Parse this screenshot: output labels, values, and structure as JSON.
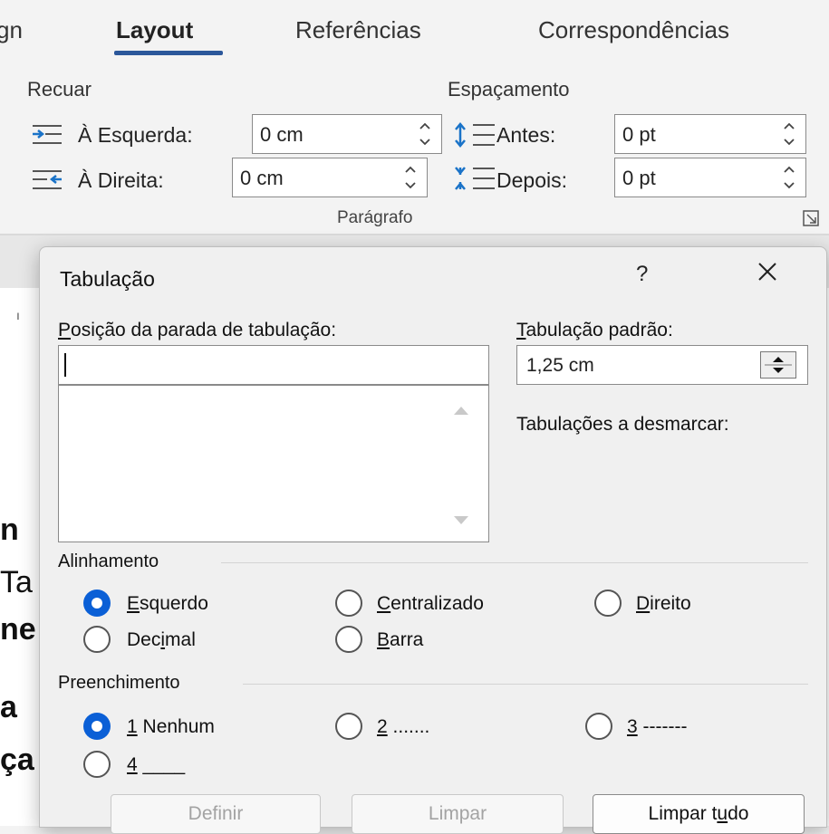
{
  "ribbon": {
    "tabs": [
      {
        "label": "gn"
      },
      {
        "label": "Layout"
      },
      {
        "label": "Referências"
      },
      {
        "label": "Correspondências"
      }
    ],
    "recuar": {
      "title": "Recuar",
      "left_label": "À Esquerda:",
      "left_value": "0 cm",
      "right_label": "À Direita:",
      "right_value": "0 cm"
    },
    "espacamento": {
      "title": "Espaçamento",
      "before_label": "Antes:",
      "before_value": "0 pt",
      "after_label": "Depois:",
      "after_value": "0 pt"
    },
    "group_label": "Parágrafo",
    "accent_color": "#2b579a"
  },
  "document": {
    "fragments": [
      "n",
      "Ta",
      "ne",
      "a",
      "ça"
    ]
  },
  "dialog": {
    "title": "Tabulação",
    "help": "?",
    "tab_stop_position": {
      "label_accesskey": "P",
      "label_rest": "osição da parada de tabulação:",
      "value": ""
    },
    "default_tab": {
      "label_accesskey": "T",
      "label_rest": "abulação padrão:",
      "value": "1,25 cm"
    },
    "to_clear_label": "Tabulações a desmarcar:",
    "alignment": {
      "legend": "Alinhamento",
      "selected": "Esquerdo",
      "options": [
        {
          "pre": "",
          "key": "E",
          "post": "squerdo"
        },
        {
          "pre": "",
          "key": "C",
          "post": "entralizado"
        },
        {
          "pre": "",
          "key": "D",
          "post": "ireito"
        },
        {
          "pre": "Dec",
          "key": "i",
          "post": "mal"
        },
        {
          "pre": "",
          "key": "B",
          "post": "arra"
        }
      ]
    },
    "leader": {
      "legend": "Preenchimento",
      "selected": "1 Nenhum",
      "options": [
        {
          "key": "1",
          "post": " Nenhum"
        },
        {
          "key": "2",
          "post": " ......."
        },
        {
          "key": "3",
          "post": " -------"
        },
        {
          "key": "4",
          "post": " ____"
        }
      ]
    },
    "buttons": {
      "set": "Definir",
      "clear": "Limpar",
      "clear_all_pre": "Limpar t",
      "clear_all_key": "u",
      "clear_all_post": "do"
    },
    "selection_color": "#0a5fd6"
  }
}
